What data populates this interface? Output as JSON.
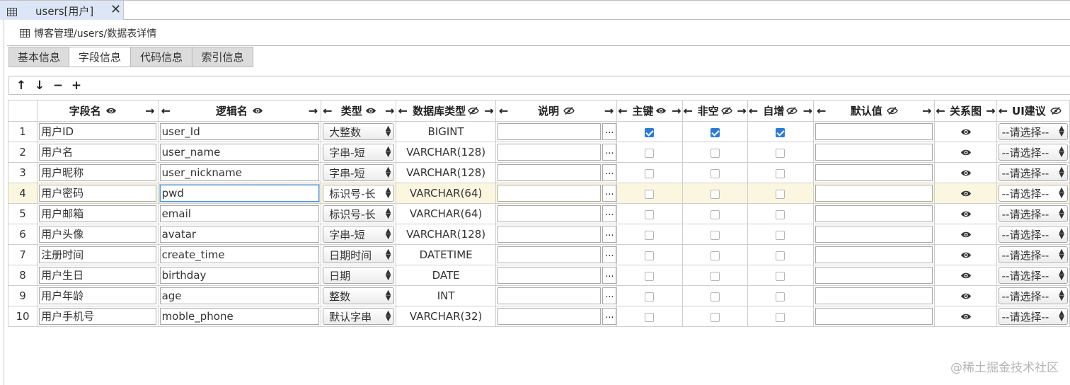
{
  "tab": {
    "title": "users[用户]",
    "close": "✕"
  },
  "breadcrumb": "博客管理/users/数据表详情",
  "subtabs": [
    "基本信息",
    "字段信息",
    "代码信息",
    "索引信息"
  ],
  "active_subtab": 1,
  "toolbar": {
    "up": "↑",
    "down": "↓",
    "remove": "−",
    "add": "+"
  },
  "headers": {
    "field_name": "字段名",
    "logic_name": "逻辑名",
    "type": "类型",
    "db_type": "数据库类型",
    "desc": "说明",
    "pk": "主键",
    "not_null": "非空",
    "auto_inc": "自增",
    "default": "默认值",
    "relation": "关系图",
    "ui": "UI建议"
  },
  "rows": [
    {
      "no": "1",
      "field": "用户ID",
      "logic": "user_Id",
      "type": "大整数",
      "db": "BIGINT",
      "pk": true,
      "nn": true,
      "ai": true,
      "ui": "--请选择--"
    },
    {
      "no": "2",
      "field": "用户名",
      "logic": "user_name",
      "type": "字串-短",
      "db": "VARCHAR(128)",
      "pk": false,
      "nn": false,
      "ai": false,
      "ui": "--请选择--"
    },
    {
      "no": "3",
      "field": "用户昵称",
      "logic": "user_nickname",
      "type": "字串-短",
      "db": "VARCHAR(128)",
      "pk": false,
      "nn": false,
      "ai": false,
      "ui": "--请选择--"
    },
    {
      "no": "4",
      "field": "用户密码",
      "logic": "pwd",
      "type": "标识号-长",
      "db": "VARCHAR(64)",
      "pk": false,
      "nn": false,
      "ai": false,
      "ui": "--请选择--"
    },
    {
      "no": "5",
      "field": "用户邮箱",
      "logic": "email",
      "type": "标识号-长",
      "db": "VARCHAR(64)",
      "pk": false,
      "nn": false,
      "ai": false,
      "ui": "--请选择--"
    },
    {
      "no": "6",
      "field": "用户头像",
      "logic": "avatar",
      "type": "字串-短",
      "db": "VARCHAR(128)",
      "pk": false,
      "nn": false,
      "ai": false,
      "ui": "--请选择--"
    },
    {
      "no": "7",
      "field": "注册时间",
      "logic": "create_time",
      "type": "日期时间",
      "db": "DATETIME",
      "pk": false,
      "nn": false,
      "ai": false,
      "ui": "--请选择--"
    },
    {
      "no": "8",
      "field": "用户生日",
      "logic": "birthday",
      "type": "日期",
      "db": "DATE",
      "pk": false,
      "nn": false,
      "ai": false,
      "ui": "--请选择--"
    },
    {
      "no": "9",
      "field": "用户年龄",
      "logic": "age",
      "type": "整数",
      "db": "INT",
      "pk": false,
      "nn": false,
      "ai": false,
      "ui": "--请选择--"
    },
    {
      "no": "10",
      "field": "用户手机号",
      "logic": "moble_phone",
      "type": "默认字串",
      "db": "VARCHAR(32)",
      "pk": false,
      "nn": false,
      "ai": false,
      "ui": "--请选择--"
    }
  ],
  "highlight_row": 3,
  "dots_label": "...",
  "watermark": "@稀土掘金技术社区",
  "colors": {
    "tab_active": "#dce6f6",
    "row_highlight": "#fbf6df",
    "checkbox_checked": "#2a7bd8"
  }
}
